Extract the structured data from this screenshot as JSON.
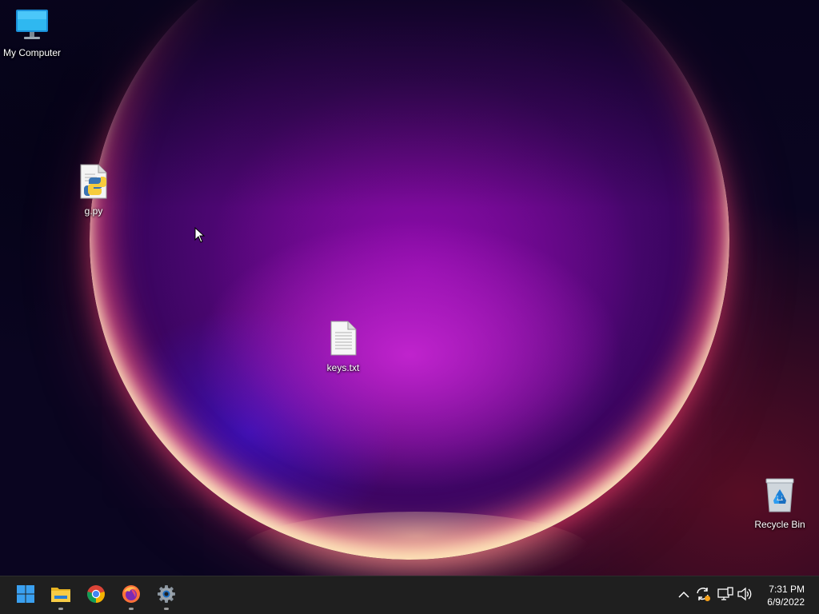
{
  "desktop": {
    "icons": [
      {
        "label": "My Computer",
        "icon": "computer-icon"
      },
      {
        "label": "g.py",
        "icon": "python-file-icon"
      },
      {
        "label": "keys.txt",
        "icon": "text-file-icon"
      },
      {
        "label": "Recycle Bin",
        "icon": "recycle-bin-icon"
      }
    ]
  },
  "taskbar": {
    "apps": [
      {
        "name": "Start",
        "icon": "windows-start-icon",
        "running": false
      },
      {
        "name": "File Explorer",
        "icon": "folder-icon",
        "running": true
      },
      {
        "name": "Google Chrome",
        "icon": "chrome-icon",
        "running": false
      },
      {
        "name": "Firefox",
        "icon": "firefox-icon",
        "running": true
      },
      {
        "name": "Settings",
        "icon": "gear-icon",
        "running": true
      }
    ],
    "tray": {
      "icons": [
        "chevron-up-icon",
        "sync-icon",
        "network-icon",
        "volume-icon"
      ],
      "time": "7:31 PM",
      "date": "6/9/2022"
    }
  },
  "colors": {
    "taskbar_bg": "#1f1f1f",
    "accent_blue": "#0078d4"
  }
}
